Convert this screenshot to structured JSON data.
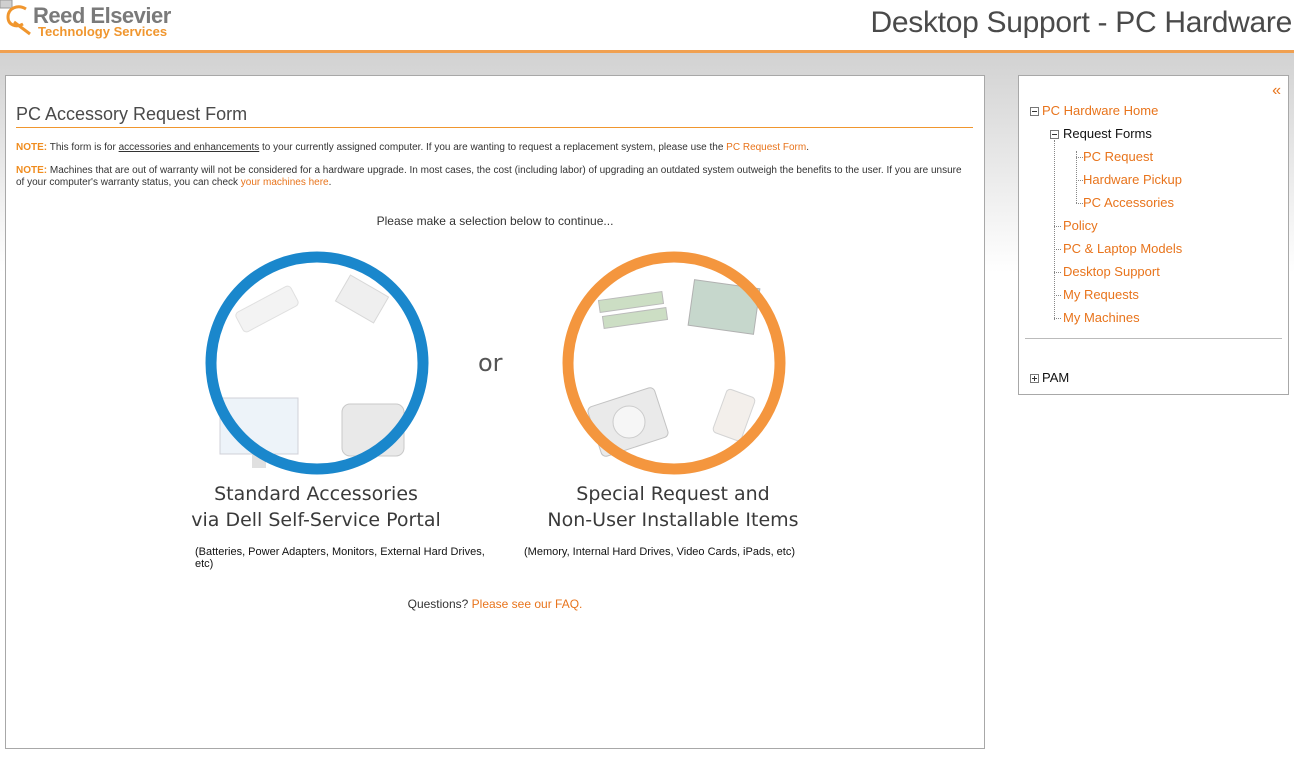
{
  "header": {
    "logo_name": "Reed Elsevier",
    "logo_sub": "Technology Services",
    "page_heading": "Desktop Support - PC Hardware"
  },
  "main": {
    "title": "PC Accessory Request Form",
    "note1": {
      "label": "NOTE:",
      "text_a": " This form is for ",
      "underlined": "accessories and enhancements",
      "text_b": " to your currently assigned computer. If you are wanting to request a replacement system, please use the ",
      "link": "PC Request Form",
      "text_c": "."
    },
    "note2": {
      "label": "NOTE:",
      "text_a": " Machines that are out of warranty will not be considered for a hardware upgrade. In most cases, the cost (including labor) of upgrading an outdated system outweigh the benefits to the user. If you are unsure of your computer's warranty status, you can check ",
      "link": "your machines here",
      "text_b": "."
    },
    "instruction": "Please make a selection below to continue...",
    "or_text": "or",
    "standard": {
      "caption_line1": "Standard Accessories",
      "caption_line2": "via Dell Self-Service Portal",
      "description": "(Batteries, Power Adapters, Monitors, External Hard Drives, etc)",
      "ring_color": "#1a87cc"
    },
    "special": {
      "caption_line1": "Special Request and",
      "caption_line2": "Non-User Installable Items",
      "description": "(Memory, Internal Hard Drives, Video Cards, iPads, etc)",
      "ring_color": "#f4963e"
    },
    "questions": {
      "text": "Questions? ",
      "link": "Please see our FAQ."
    }
  },
  "sidebar": {
    "collapse_label": "«",
    "home": "PC Hardware Home",
    "request_forms": "Request Forms",
    "pc_request": "PC Request",
    "hardware_pickup": "Hardware Pickup",
    "pc_accessories": "PC Accessories",
    "policy": "Policy",
    "models": "PC & Laptop Models",
    "desktop_support": "Desktop Support",
    "my_requests": "My Requests",
    "my_machines": "My Machines",
    "pam": "PAM"
  },
  "colors": {
    "accent": "#e8741c",
    "header_rule": "#f0a050"
  }
}
